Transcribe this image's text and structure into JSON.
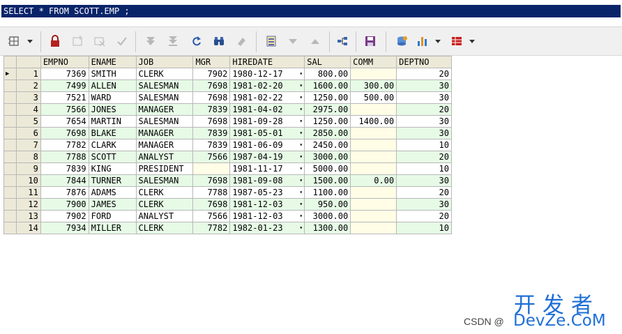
{
  "sql": "SELECT * FROM SCOTT.EMP ;",
  "toolbar": {
    "icons": [
      "grid-layout-icon",
      "lock-icon",
      "insert-row-icon",
      "delete-row-icon",
      "post-changes-icon",
      "fetch-next-icon",
      "fetch-last-icon",
      "refresh-icon",
      "find-icon",
      "clear-icon",
      "single-record-icon",
      "query-down-icon",
      "query-up-icon",
      "export-tree-icon",
      "save-icon",
      "connect-icon",
      "chart-icon",
      "table-icon"
    ]
  },
  "grid": {
    "columns": [
      "EMPNO",
      "ENAME",
      "JOB",
      "MGR",
      "HIREDATE",
      "SAL",
      "COMM",
      "DEPTNO"
    ],
    "rows": [
      {
        "n": "1",
        "empno": "7369",
        "ename": "SMITH",
        "job": "CLERK",
        "mgr": "7902",
        "hiredate": "1980-12-17",
        "sal": "800.00",
        "comm": "",
        "deptno": "20"
      },
      {
        "n": "2",
        "empno": "7499",
        "ename": "ALLEN",
        "job": "SALESMAN",
        "mgr": "7698",
        "hiredate": "1981-02-20",
        "sal": "1600.00",
        "comm": "300.00",
        "deptno": "30"
      },
      {
        "n": "3",
        "empno": "7521",
        "ename": "WARD",
        "job": "SALESMAN",
        "mgr": "7698",
        "hiredate": "1981-02-22",
        "sal": "1250.00",
        "comm": "500.00",
        "deptno": "30"
      },
      {
        "n": "4",
        "empno": "7566",
        "ename": "JONES",
        "job": "MANAGER",
        "mgr": "7839",
        "hiredate": "1981-04-02",
        "sal": "2975.00",
        "comm": "",
        "deptno": "20"
      },
      {
        "n": "5",
        "empno": "7654",
        "ename": "MARTIN",
        "job": "SALESMAN",
        "mgr": "7698",
        "hiredate": "1981-09-28",
        "sal": "1250.00",
        "comm": "1400.00",
        "deptno": "30"
      },
      {
        "n": "6",
        "empno": "7698",
        "ename": "BLAKE",
        "job": "MANAGER",
        "mgr": "7839",
        "hiredate": "1981-05-01",
        "sal": "2850.00",
        "comm": "",
        "deptno": "30"
      },
      {
        "n": "7",
        "empno": "7782",
        "ename": "CLARK",
        "job": "MANAGER",
        "mgr": "7839",
        "hiredate": "1981-06-09",
        "sal": "2450.00",
        "comm": "",
        "deptno": "10"
      },
      {
        "n": "8",
        "empno": "7788",
        "ename": "SCOTT",
        "job": "ANALYST",
        "mgr": "7566",
        "hiredate": "1987-04-19",
        "sal": "3000.00",
        "comm": "",
        "deptno": "20"
      },
      {
        "n": "9",
        "empno": "7839",
        "ename": "KING",
        "job": "PRESIDENT",
        "mgr": "",
        "hiredate": "1981-11-17",
        "sal": "5000.00",
        "comm": "",
        "deptno": "10"
      },
      {
        "n": "10",
        "empno": "7844",
        "ename": "TURNER",
        "job": "SALESMAN",
        "mgr": "7698",
        "hiredate": "1981-09-08",
        "sal": "1500.00",
        "comm": "0.00",
        "deptno": "30"
      },
      {
        "n": "11",
        "empno": "7876",
        "ename": "ADAMS",
        "job": "CLERK",
        "mgr": "7788",
        "hiredate": "1987-05-23",
        "sal": "1100.00",
        "comm": "",
        "deptno": "20"
      },
      {
        "n": "12",
        "empno": "7900",
        "ename": "JAMES",
        "job": "CLERK",
        "mgr": "7698",
        "hiredate": "1981-12-03",
        "sal": "950.00",
        "comm": "",
        "deptno": "30"
      },
      {
        "n": "13",
        "empno": "7902",
        "ename": "FORD",
        "job": "ANALYST",
        "mgr": "7566",
        "hiredate": "1981-12-03",
        "sal": "3000.00",
        "comm": "",
        "deptno": "20"
      },
      {
        "n": "14",
        "empno": "7934",
        "ename": "MILLER",
        "job": "CLERK",
        "mgr": "7782",
        "hiredate": "1982-01-23",
        "sal": "1300.00",
        "comm": "",
        "deptno": "10"
      }
    ]
  },
  "watermark": {
    "cn": "开发者",
    "en": "DevZe.CoM",
    "csdn": "CSDN @"
  },
  "colors": {
    "selection": "#0a246a",
    "row_even": "#e6fae6",
    "null_cell": "#fffde6",
    "watermark": "#1e6fd6"
  }
}
